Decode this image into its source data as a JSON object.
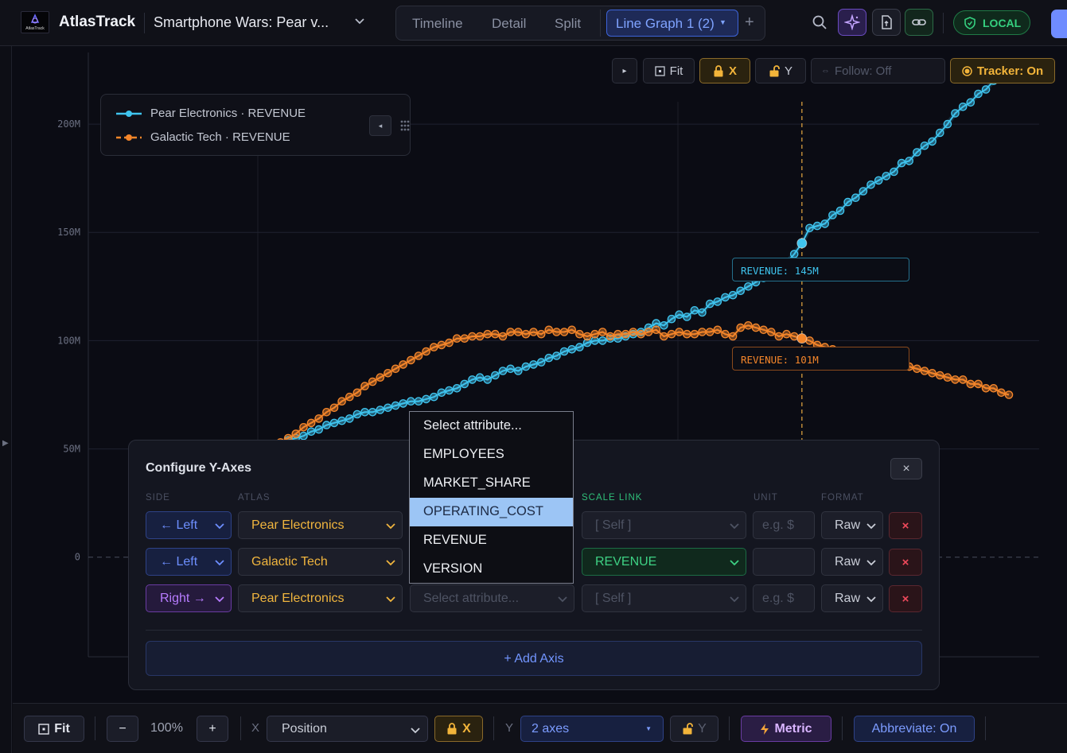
{
  "app": {
    "name": "AtlasTrack",
    "logo_text": "AtlasTrack"
  },
  "document": {
    "title": "Smartphone Wars: Pear v..."
  },
  "tabs": [
    {
      "label": "Timeline"
    },
    {
      "label": "Detail"
    },
    {
      "label": "Split"
    }
  ],
  "active_tab": {
    "label": "Line Graph 1 (2)"
  },
  "status": {
    "local_label": "LOCAL"
  },
  "chart_toolbar": {
    "play_label": "▸",
    "fit_label": "Fit",
    "x_lock_label": "X",
    "y_lock_label": "Y",
    "follow_label": "Follow: Off",
    "tracker_label": "Tracker: On"
  },
  "legend": {
    "series": [
      {
        "label": "Pear Electronics · REVENUE"
      },
      {
        "label": "Galactic Tech · REVENUE"
      }
    ],
    "collapse_label": "◂"
  },
  "tracker": {
    "labels": [
      {
        "text": "REVENUE: 145M"
      },
      {
        "text": "REVENUE: 101M"
      }
    ]
  },
  "colors": {
    "series1": "#3fc4ee",
    "series2": "#f5862a",
    "accent": "#5b7cff",
    "tracker": "#c8923a"
  },
  "chart_data": {
    "type": "line",
    "y_ticks": [
      "200M",
      "150M",
      "100M",
      "50M",
      "0"
    ],
    "ylim": [
      -46,
      225
    ],
    "x_count": 100,
    "tracker_x_index": 72,
    "series": [
      {
        "name": "Pear Electronics · REVENUE",
        "color": "#3fc4ee",
        "values": [
          47,
          48,
          50,
          51,
          52,
          54,
          55,
          56,
          58,
          59,
          61,
          62,
          63,
          64,
          66,
          67,
          67,
          68,
          69,
          70,
          71,
          72,
          72,
          73,
          74,
          76,
          77,
          78,
          80,
          82,
          83,
          82,
          84,
          86,
          87,
          86,
          88,
          89,
          90,
          92,
          93,
          95,
          96,
          97,
          99,
          100,
          100,
          101,
          101,
          102,
          103,
          104,
          106,
          108,
          107,
          110,
          112,
          111,
          114,
          113,
          117,
          118,
          120,
          121,
          123,
          125,
          127,
          129,
          132,
          133,
          136,
          140,
          145,
          152,
          153,
          154,
          158,
          160,
          164,
          166,
          169,
          172,
          174,
          176,
          178,
          182,
          183,
          187,
          190,
          192,
          196,
          200,
          205,
          208,
          210,
          214,
          216,
          220,
          223,
          226
        ],
        "tracker_value": 145
      },
      {
        "name": "Galactic Tech · REVENUE",
        "color": "#f5862a",
        "values": [
          45,
          47,
          49,
          51,
          53,
          55,
          57,
          60,
          62,
          64,
          67,
          69,
          72,
          74,
          76,
          79,
          81,
          83,
          85,
          87,
          89,
          91,
          93,
          95,
          97,
          98,
          99,
          101,
          101,
          102,
          102,
          103,
          103,
          102,
          104,
          104,
          103,
          104,
          103,
          105,
          104,
          104,
          105,
          103,
          102,
          103,
          104,
          102,
          103,
          103,
          104,
          103,
          104,
          105,
          102,
          103,
          104,
          103,
          103,
          104,
          104,
          105,
          103,
          102,
          106,
          107,
          106,
          105,
          104,
          102,
          103,
          102,
          101,
          100,
          98,
          97,
          96,
          95,
          94,
          94,
          93,
          92,
          91,
          90,
          90,
          89,
          88,
          87,
          86,
          85,
          84,
          83,
          82,
          82,
          80,
          80,
          78,
          78,
          76,
          75
        ],
        "tracker_value": 101
      }
    ]
  },
  "dialog": {
    "title": "Configure Y-Axes",
    "close_label": "×",
    "columns": {
      "side": "SIDE",
      "atlas": "ATLAS",
      "scale_link": "SCALE LINK",
      "unit": "UNIT",
      "format": "FORMAT"
    },
    "rows": [
      {
        "side": "← Left",
        "atlas": "Pear Electronics",
        "attribute": "",
        "scale_link": "[ Self ]",
        "unit": "",
        "unit_placeholder": "e.g. $",
        "format": "Raw"
      },
      {
        "side": "← Left",
        "atlas": "Galactic Tech",
        "attribute": "",
        "scale_link": "REVENUE",
        "unit": "",
        "unit_placeholder": "",
        "format": "Raw"
      },
      {
        "side": "Right →",
        "atlas": "Pear Electronics",
        "attribute": "Select attribute...",
        "scale_link": "[ Self ]",
        "unit": "",
        "unit_placeholder": "e.g. $",
        "format": "Raw"
      }
    ],
    "delete_label": "×",
    "add_axis_label": "+ Add Axis"
  },
  "dropdown": {
    "options": [
      "Select attribute...",
      "EMPLOYEES",
      "MARKET_SHARE",
      "OPERATING_COST",
      "REVENUE",
      "VERSION"
    ],
    "highlighted": "OPERATING_COST"
  },
  "bottom_bar": {
    "fit_label": "Fit",
    "zoom_out_label": "−",
    "zoom_value": "100%",
    "zoom_in_label": "+",
    "x_label": "X",
    "x_select": "Position",
    "x_lock_label": "X",
    "y_label": "Y",
    "y_select": "2 axes",
    "y_lock_label": "Y",
    "metric_label": "Metric",
    "abbreviate_label": "Abbreviate: On"
  }
}
